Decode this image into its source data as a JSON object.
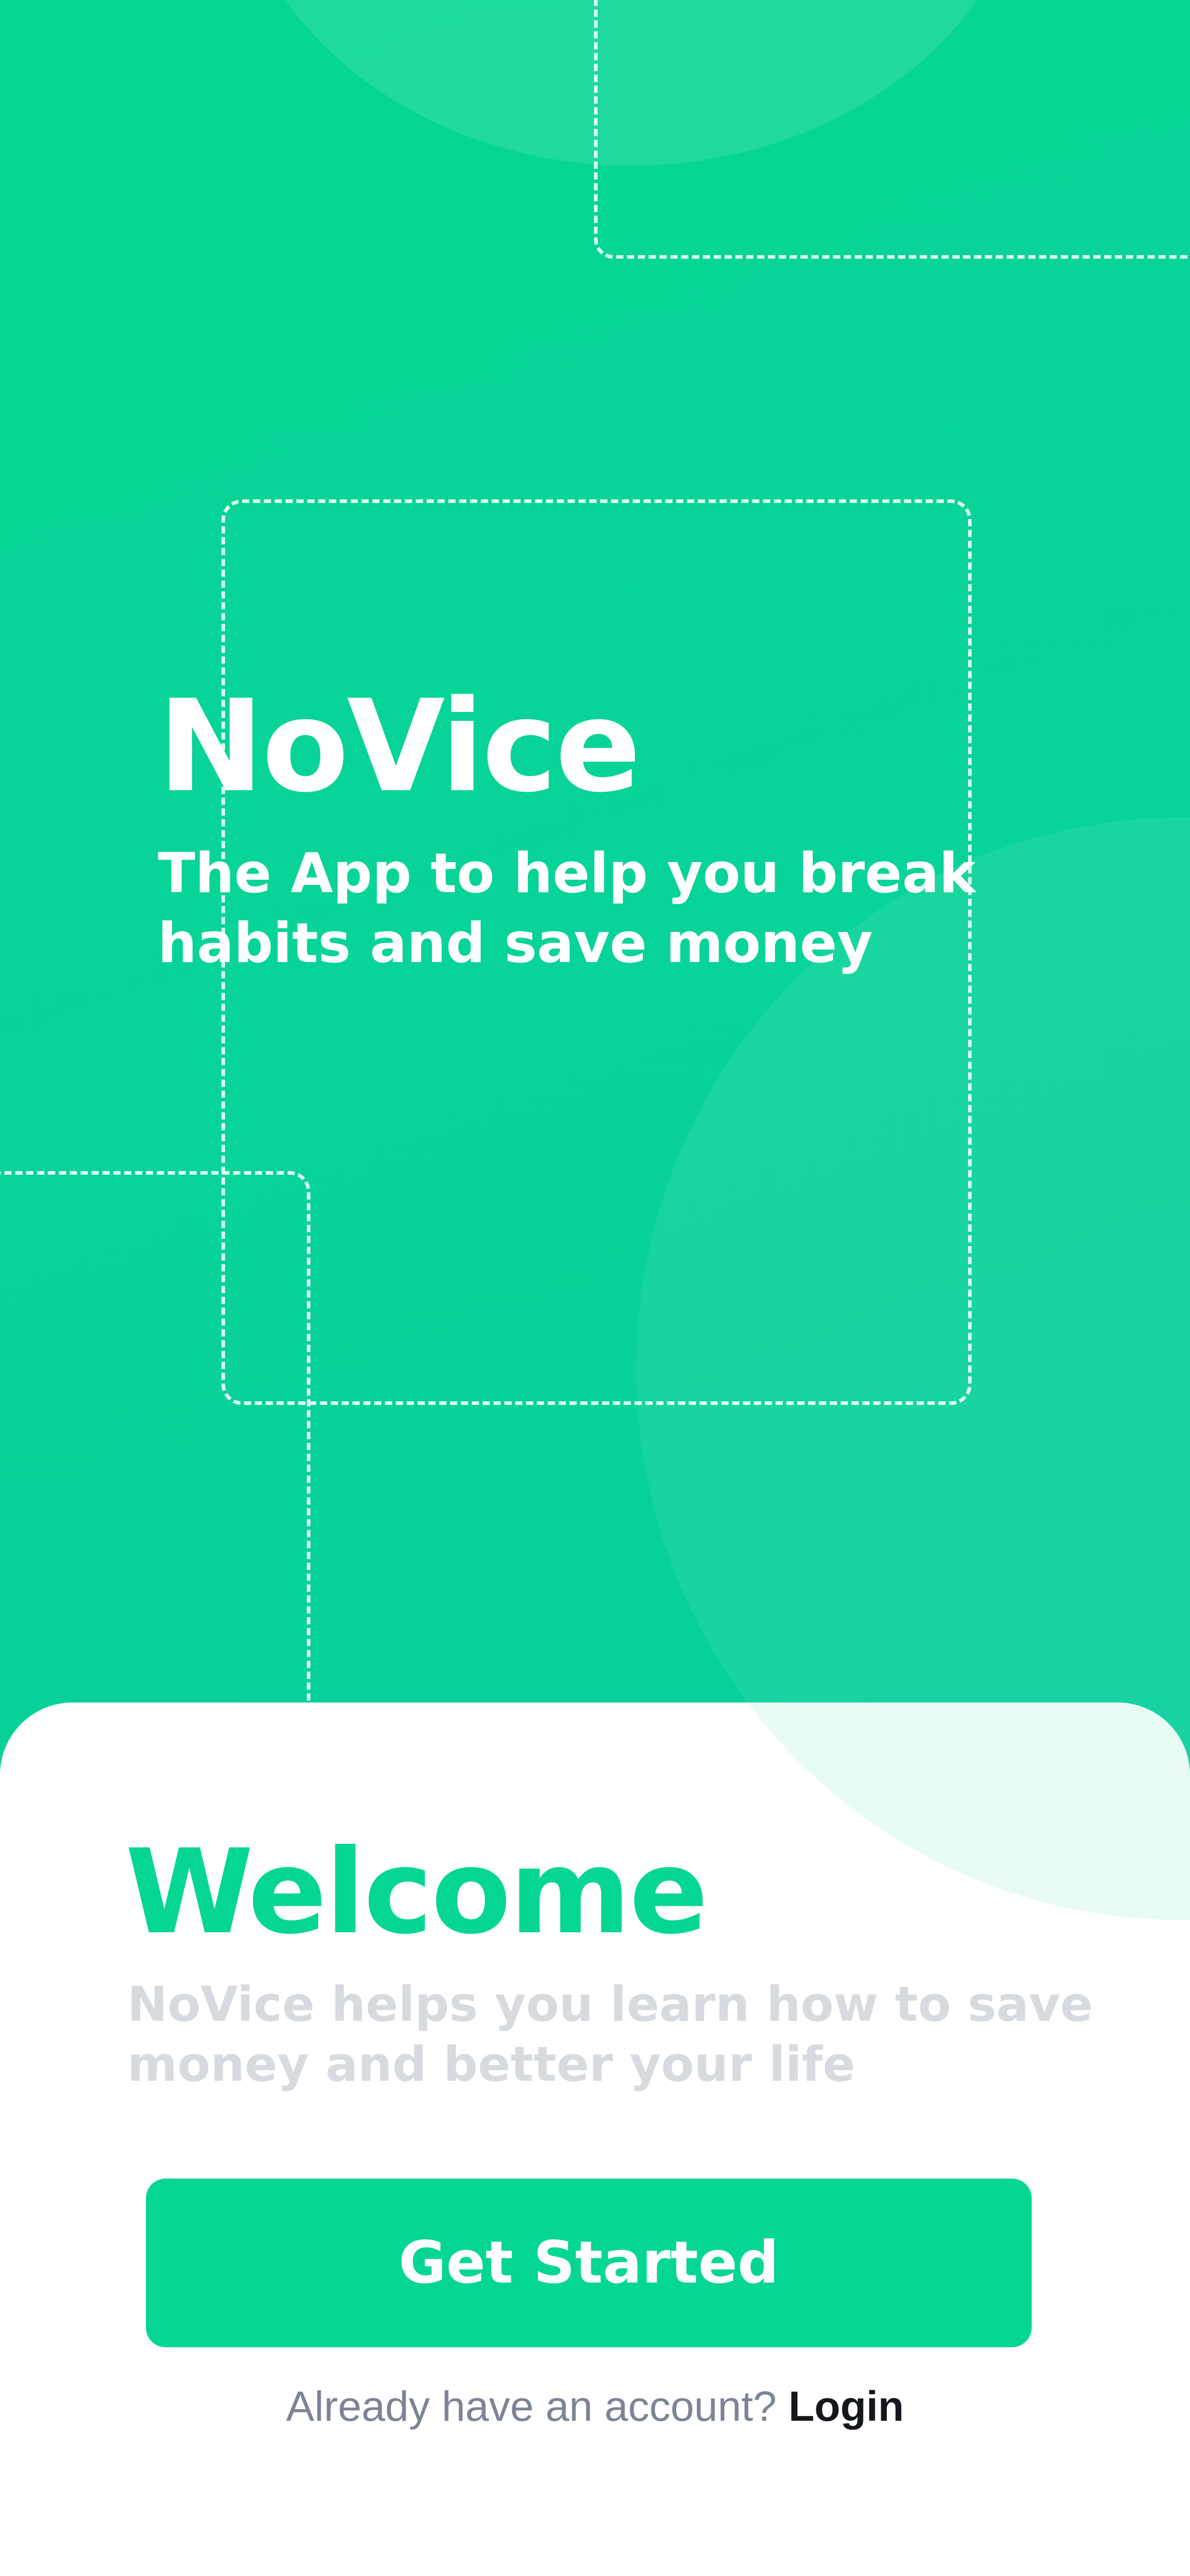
{
  "hero": {
    "brand": "NoVice",
    "tagline": "The App to help you break habits and save money"
  },
  "welcome": {
    "title": "Welcome",
    "description": "NoVice helps you learn how to save money and better your life"
  },
  "actions": {
    "get_started_label": "Get Started",
    "login_prompt": "Already have an account?",
    "login_label": "Login"
  },
  "colors": {
    "brand_green": "#06d694",
    "muted_text": "#d7dbdf",
    "prompt_text": "#7c8496"
  }
}
